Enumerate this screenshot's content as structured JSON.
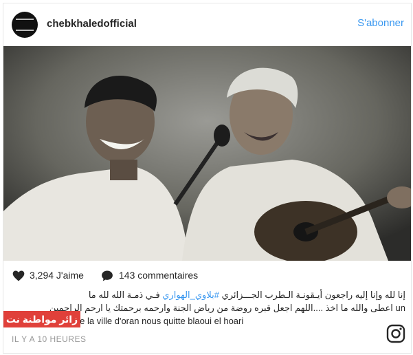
{
  "post": {
    "username": "chebkhaledofficial",
    "follow_label": "S'abonner",
    "likes_label": "3,294 J'aime",
    "comments_label": "143 commentaires",
    "caption_arabic_line1": "إنا لله وإنا إليه راجعون أيـقونـة الـطرب الجـــزائري",
    "caption_hashtag": "#بلاوي_الهواري",
    "caption_arabic_line1_end": "فـي ذمـة الله لله ما",
    "caption_arabic_line2": "اعطى والله ما اخذ ....اللهم اجعل قبره روضة من رياض الجنة وارحمه برحمتك يا ارحم الراحمين",
    "caption_french_un": "un",
    "caption_french": "Grand Symbole de la ville d'oran nous quitte blaoui el hoari",
    "timestamp": "IL Y A 10 HEURES",
    "watermark": "زائر مواطنة نت"
  },
  "icons": {
    "avatar": "profile-logo",
    "heart": "heart-icon",
    "comment": "comment-bubble-icon",
    "brand": "instagram-icon"
  },
  "colors": {
    "follow": "#3897f0",
    "watermark": "#e0403a",
    "text": "#262626",
    "muted": "#999999"
  }
}
